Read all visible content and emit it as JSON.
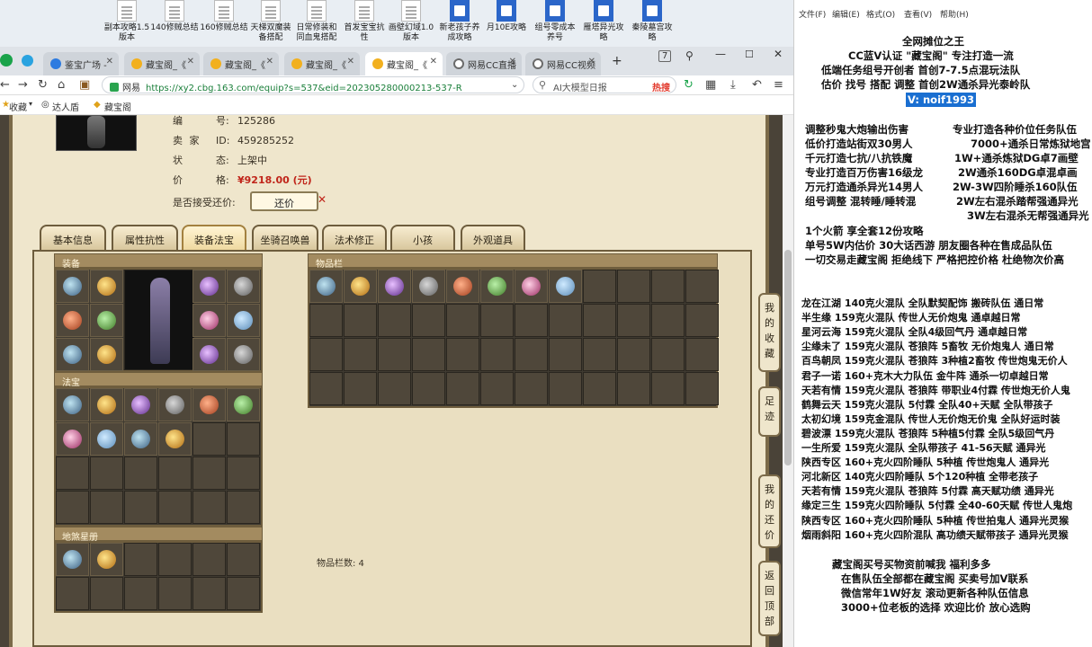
{
  "desktop": {
    "icons": [
      {
        "label": "副本攻略1.5\n版本",
        "type": "doc"
      },
      {
        "label": "140修贼总结",
        "type": "doc"
      },
      {
        "label": "160修贼总结",
        "type": "doc"
      },
      {
        "label": "天梯双魔装\n备搭配",
        "type": "doc"
      },
      {
        "label": "日常修装和\n同血鬼搭配",
        "type": "doc"
      },
      {
        "label": "首发宝宝抗\n性",
        "type": "doc"
      },
      {
        "label": "画壁幻域1.0\n版本",
        "type": "doc"
      },
      {
        "label": "新老孩子养\n成攻略",
        "type": "word"
      },
      {
        "label": "月10E攻略",
        "type": "word"
      },
      {
        "label": "组号零成本\n养号",
        "type": "word"
      },
      {
        "label": "雁塔异光攻\n略",
        "type": "word"
      },
      {
        "label": "秦陵墓宫攻\n略",
        "type": "word"
      }
    ]
  },
  "browser": {
    "tabs": [
      {
        "label": "鉴宝广场 -",
        "icon": "blue"
      },
      {
        "label": "藏宝阁_《",
        "icon": "gold"
      },
      {
        "label": "藏宝阁_《",
        "icon": "gold"
      },
      {
        "label": "藏宝阁_《",
        "icon": "gold"
      },
      {
        "label": "藏宝阁_《",
        "icon": "gold",
        "active": true
      },
      {
        "label": "网易CC直播",
        "icon": "ring"
      },
      {
        "label": "网易CC视频",
        "icon": "ring"
      }
    ],
    "new_tab": "+",
    "tab_count": "7",
    "url_site": "网易",
    "url": "https://xy2.cbg.163.com/equip?s=537&eid=202305280000213-537-R",
    "search_placeholder": "AI大模型日报",
    "search_hot": "热搜",
    "bookmarks": {
      "collect": "收藏",
      "item1": "达人盾",
      "item2": "藏宝阁"
    }
  },
  "listing": {
    "rows": [
      {
        "label": "编",
        "sub": "号:",
        "value": "125286"
      },
      {
        "label": "卖 家",
        "sub": "ID:",
        "value": "459285252"
      },
      {
        "label": "状",
        "sub": "态:",
        "value": "上架中"
      },
      {
        "label": "价",
        "sub": "格:",
        "value": "¥9218.00 (元)"
      }
    ],
    "bargain_label": "是否接受还价:",
    "bargain_button": "还价",
    "bargain_x": "✕"
  },
  "tabs": [
    {
      "label": "基本信息"
    },
    {
      "label": "属性抗性"
    },
    {
      "label": "装备法宝",
      "active": true
    },
    {
      "label": "坐骑召唤兽"
    },
    {
      "label": "法术修正"
    },
    {
      "label": "小孩"
    },
    {
      "label": "外观道具"
    }
  ],
  "sections": {
    "equipment": "装备",
    "fabao": "法宝",
    "dijiang": "地煞星册",
    "inventory": "物品栏",
    "inventory_count": "物品栏数: 4"
  },
  "side_buttons": [
    {
      "label": "我的收藏"
    },
    {
      "label": "足迹"
    },
    {
      "label": "我的还价"
    },
    {
      "label": "返回顶部"
    }
  ],
  "editor": {
    "menu": [
      "文件(F)",
      "编辑(E)",
      "格式(O)",
      "查看(V)",
      "帮助(H)"
    ],
    "header_lines": [
      "全网摊位之王",
      "CC蓝V认证 \"藏宝阁\" 专注打造一流",
      "低端任务组号开创者        首创7-7.5点混玩法队",
      "估价 找号 搭配 调整        首创2W通杀异光泰岭队"
    ],
    "contact": "V: noif1993",
    "service_left": [
      "调整秒鬼大炮输出伤害",
      "低价打造站街双30男人",
      "千元打造七抗/八抗铁魔",
      "专业打造百万伤害16级龙",
      "万元打造通杀异光14男人",
      "组号调整 混转睡/睡转混"
    ],
    "service_right": [
      "专业打造各种价位任务队伍",
      "7000+通杀日常炼狱地宫",
      "1W+通杀炼狱DG卓7画壁",
      "2W通杀160DG卓混卓画",
      "2W-3W四阶睡杀160队伍",
      "2W左右混杀踏帮强通异光",
      "3W左右混杀无帮强通异光"
    ],
    "mid_lines": [
      "1个火箭 享全套12份攻略",
      "单号5W内估价 30大话西游        朋友圈各种在售成品队伍",
      "一切交易走藏宝阁 拒绝线下     严格把控价格 杜绝物次价高"
    ],
    "teams": [
      "龙在江湖 140克火混队 全队默契配饰 搬砖队伍 通日常",
      "半生缘     159克火混队 传世人无价炮鬼 通卓越日常",
      "星河云海 159克火混队 全队4级回气丹 通卓越日常",
      "尘缘未了 159克火混队 苍狼阵 5畜牧 无价炮鬼人 通日常",
      "百鸟朝凤 159克火混队 苍狼阵 3种植2畜牧 传世炮鬼无价人",
      "君子一诺 160+克木大力队伍 金牛阵 通杀一切卓越日常",
      "天若有情 159克火混队 苍狼阵 带职业4付霖 传世炮无价人鬼",
      "鹤舞云天 159克火混队 5付霖 全队40+天赋 全队带孩子",
      "太初幻境 159克金混队 传世人无价炮无价鬼 全队好运时装",
      "碧波漂     159克火混队 苍狼阵 5种植5付霖 全队5级回气丹",
      "一生所爱 159克火混队 全队带孩子 41-56天赋 通异光",
      "陕西专区 160+克火四阶睡队 5种植 传世炮鬼人 通异光",
      "河北新区 140克火四阶睡队 5个120种植 全带老孩子",
      "天若有情 159克火混队 苍狼阵 5付霖 高天赋功绩 通异光",
      "缘定三生 159克火四阶睡队 5付霖 全40-60天赋 传世人鬼炮",
      "陕西专区 160+克火四阶睡队 5种植 传世拍鬼人 通异光灵猴",
      "烟雨斜阳 160+克火四阶混队 高功绩天赋带孩子 通异光灵猴"
    ],
    "footer_lines": [
      "藏宝阁买号买物资前喊我 福利多多",
      "在售队伍全部都在藏宝阁 买卖号加V联系",
      "微信常年1W好友 滚动更新各种队伍信息",
      "3000+位老板的选择 欢迎比价 放心选购"
    ]
  }
}
